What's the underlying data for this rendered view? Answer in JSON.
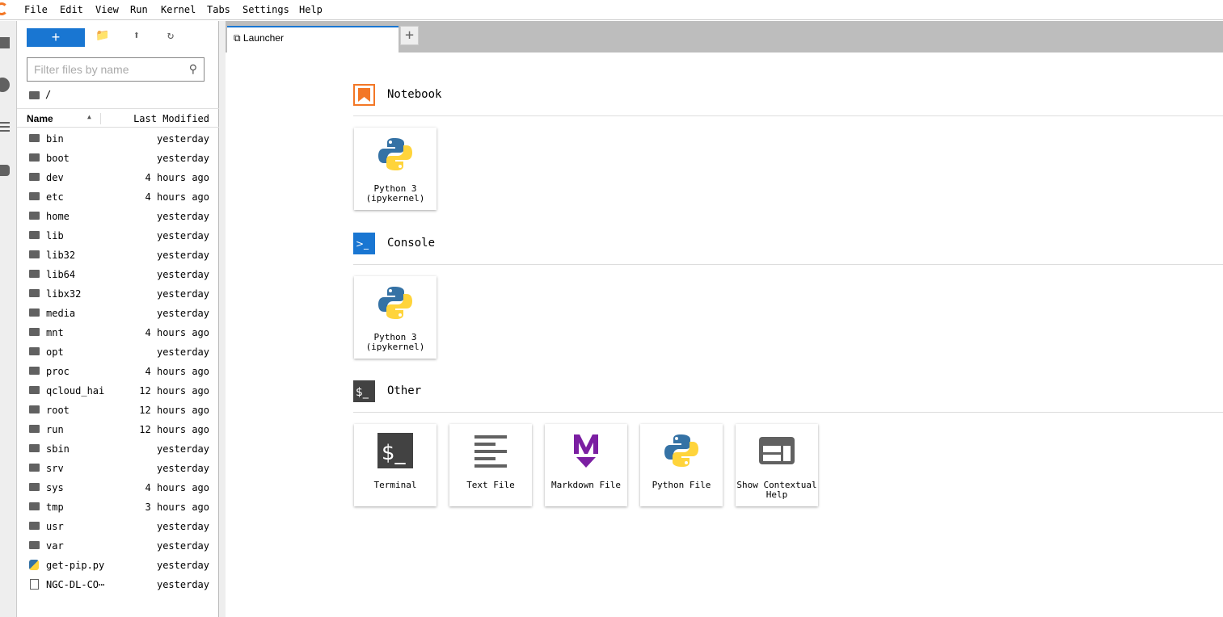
{
  "menu": [
    "File",
    "Edit",
    "View",
    "Run",
    "Kernel",
    "Tabs",
    "Settings",
    "Help"
  ],
  "sidebar": {
    "new_label": "+",
    "filter_placeholder": "Filter files by name",
    "breadcrumb": "/",
    "col_name": "Name",
    "col_modified": "Last Modified",
    "files": [
      {
        "name": "bin",
        "modified": "yesterday",
        "type": "folder"
      },
      {
        "name": "boot",
        "modified": "yesterday",
        "type": "folder"
      },
      {
        "name": "dev",
        "modified": "4 hours ago",
        "type": "folder"
      },
      {
        "name": "etc",
        "modified": "4 hours ago",
        "type": "folder"
      },
      {
        "name": "home",
        "modified": "yesterday",
        "type": "folder"
      },
      {
        "name": "lib",
        "modified": "yesterday",
        "type": "folder"
      },
      {
        "name": "lib32",
        "modified": "yesterday",
        "type": "folder"
      },
      {
        "name": "lib64",
        "modified": "yesterday",
        "type": "folder"
      },
      {
        "name": "libx32",
        "modified": "yesterday",
        "type": "folder"
      },
      {
        "name": "media",
        "modified": "yesterday",
        "type": "folder"
      },
      {
        "name": "mnt",
        "modified": "4 hours ago",
        "type": "folder"
      },
      {
        "name": "opt",
        "modified": "yesterday",
        "type": "folder"
      },
      {
        "name": "proc",
        "modified": "4 hours ago",
        "type": "folder"
      },
      {
        "name": "qcloud_hai",
        "modified": "12 hours ago",
        "type": "folder"
      },
      {
        "name": "root",
        "modified": "12 hours ago",
        "type": "folder"
      },
      {
        "name": "run",
        "modified": "12 hours ago",
        "type": "folder"
      },
      {
        "name": "sbin",
        "modified": "yesterday",
        "type": "folder"
      },
      {
        "name": "srv",
        "modified": "yesterday",
        "type": "folder"
      },
      {
        "name": "sys",
        "modified": "4 hours ago",
        "type": "folder"
      },
      {
        "name": "tmp",
        "modified": "3 hours ago",
        "type": "folder"
      },
      {
        "name": "usr",
        "modified": "yesterday",
        "type": "folder"
      },
      {
        "name": "var",
        "modified": "yesterday",
        "type": "folder"
      },
      {
        "name": "get-pip.py",
        "modified": "yesterday",
        "type": "python"
      },
      {
        "name": "NGC-DL-CO⋯",
        "modified": "yesterday",
        "type": "file"
      }
    ]
  },
  "tabs": [
    {
      "label": "Launcher"
    }
  ],
  "launcher": {
    "notebook": {
      "title": "Notebook",
      "cards": [
        {
          "label": "Python 3\n(ipykernel)",
          "icon": "python-icon"
        }
      ]
    },
    "console": {
      "title": "Console",
      "cards": [
        {
          "label": "Python 3\n(ipykernel)",
          "icon": "python-icon"
        }
      ]
    },
    "other": {
      "title": "Other",
      "cards": [
        {
          "label": "Terminal",
          "icon": "terminal-icon"
        },
        {
          "label": "Text File",
          "icon": "text-file-icon"
        },
        {
          "label": "Markdown File",
          "icon": "markdown-icon"
        },
        {
          "label": "Python File",
          "icon": "python-icon"
        },
        {
          "label": "Show Contextual\nHelp",
          "icon": "help-icon"
        }
      ]
    }
  },
  "colors": {
    "accent": "#1976d2",
    "notebook": "#f37726",
    "markdown": "#7b1fa2"
  }
}
